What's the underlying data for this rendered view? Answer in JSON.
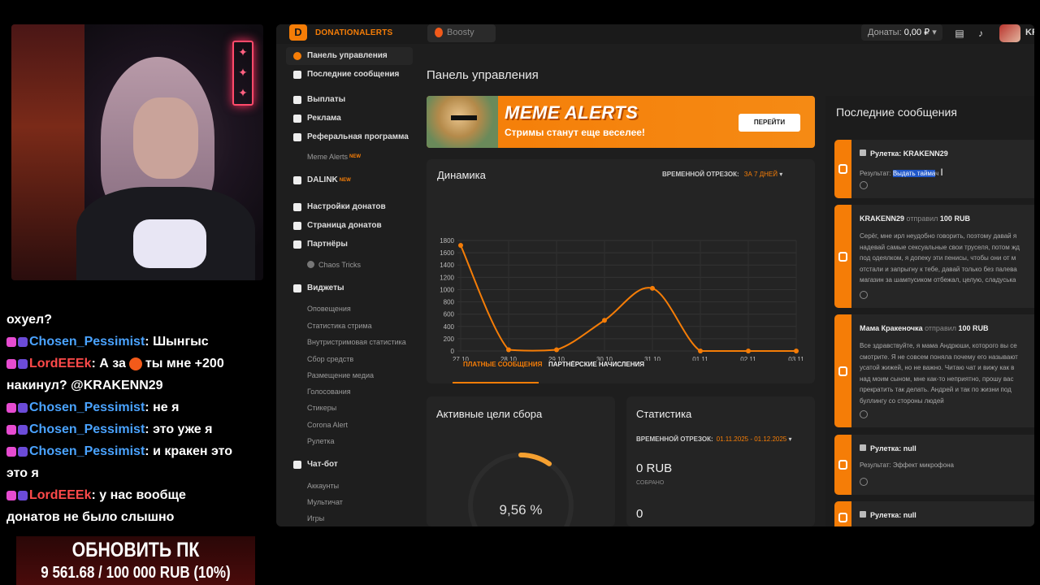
{
  "stream": {
    "chat": [
      {
        "user": "",
        "text": "охуел?"
      },
      {
        "user": "Chosen_Pessimist",
        "text": "Шынгыс"
      },
      {
        "user": "LordEEEk",
        "text": "А за",
        "tail": "ты мне +200"
      },
      {
        "user": "",
        "text": "накинул? @KRAKENN29"
      },
      {
        "user": "Chosen_Pessimist",
        "text": "не я"
      },
      {
        "user": "Chosen_Pessimist",
        "text": "это уже я"
      },
      {
        "user": "Chosen_Pessimist",
        "text": "и кракен это"
      },
      {
        "user": "",
        "text": "это я"
      },
      {
        "user": "LordEEEk",
        "text": "у нас вообще"
      },
      {
        "user": "",
        "text": "донатов не было слышно"
      }
    ],
    "goal": {
      "title": "ОБНОВИТЬ ПК",
      "progress_text": "9 561.68 / 100 000 RUB (10%)",
      "progress": 0.0956
    }
  },
  "app": {
    "brand": "DONATIONALERTS",
    "tab": "Boosty",
    "donations_label": "Донаты:",
    "donations_value": "0,00 ₽",
    "user_short": "KR",
    "sidebar": [
      {
        "label": "Панель управления",
        "active": true
      },
      {
        "label": "Последние сообщения"
      },
      {
        "label": "Выплаты"
      },
      {
        "label": "Реклама"
      },
      {
        "label": "Реферальная программа"
      },
      {
        "label": "Meme Alerts",
        "sub": true,
        "new": "NEW"
      },
      {
        "label": "DALINK",
        "new": "NEW"
      },
      {
        "label": "Настройки донатов"
      },
      {
        "label": "Страница донатов"
      },
      {
        "label": "Партнёры"
      },
      {
        "label": "Chaos Tricks",
        "sub": true
      },
      {
        "label": "Виджеты"
      },
      {
        "label": "Оповещения",
        "sub": true
      },
      {
        "label": "Статистика стрима",
        "sub": true
      },
      {
        "label": "Внутристримовая статистика",
        "sub": true
      },
      {
        "label": "Сбор средств",
        "sub": true
      },
      {
        "label": "Размещение медиа",
        "sub": true
      },
      {
        "label": "Голосования",
        "sub": true
      },
      {
        "label": "Стикеры",
        "sub": true
      },
      {
        "label": "Corona Alert",
        "sub": true
      },
      {
        "label": "Рулетка",
        "sub": true
      },
      {
        "label": "Чат-бот"
      },
      {
        "label": "Аккаунты",
        "sub": true
      },
      {
        "label": "Мультичат",
        "sub": true
      },
      {
        "label": "Игры",
        "sub": true
      }
    ],
    "page_title": "Панель управления",
    "banner": {
      "title": "MEME ALERTS",
      "subtitle": "Стримы станут еще веселее!",
      "button": "ПЕРЕЙТИ"
    },
    "dynamics": {
      "title": "Динамика",
      "period_label": "ВРЕМЕННОЙ ОТРЕЗОК:",
      "period_value": "ЗА 7 ДНЕЙ",
      "tab1": "ПЛАТНЫЕ СООБЩЕНИЯ",
      "tab2": "ПАРТНЁРСКИЕ НАЧИСЛЕНИЯ"
    },
    "goals": {
      "title": "Активные цели сбора",
      "percent": "9,56 %",
      "fraction": 0.0956
    },
    "stats": {
      "title": "Статистика",
      "period_label": "ВРЕМЕННОЙ ОТРЕЗОК:",
      "period_value": "01.11.2025 - 01.12.2025",
      "collected": "0 RUB",
      "collected_label": "СОБРАНО",
      "second": "0"
    },
    "messages": {
      "title": "Последние сообщения",
      "items": [
        {
          "header": "Рулетка: KRAKENN29",
          "result_label": "Результат:",
          "result": "Выдать тайма",
          "cut": "ч"
        },
        {
          "name": "KRAKENN29",
          "sent": "отправил",
          "amount": "100 RUB",
          "lines": [
            "Серёг, мне ирл неудобно говорить, поэтому давай я",
            "надевай самые сексуальные свои труселя, потом жд",
            "под одеялком, я допеку эти пенисы, чтобы они от м",
            "отстали и запрыгну к тебе, давай только без палева",
            "магазин за шампусиком отбежал, целую, сладуська"
          ]
        },
        {
          "name": "Мама Кракеночка",
          "sent": "отправил",
          "amount": "100 RUB",
          "lines": [
            "Все здравствуйте, я мама Андрюши, которого вы се",
            "смотрите. Я не совсем поняла почему его называют",
            "усатой жижей, но не важно. Читаю чат и вижу как в",
            "над моим сыном, мне как-то неприятно, прошу вас",
            "прекратить так делать. Андрей и так по жизни под",
            "буллингу со стороны людей"
          ]
        },
        {
          "header": "Рулетка: null",
          "result_label": "Результат:",
          "result": "Эффект микрофона"
        },
        {
          "header": "Рулетка: null"
        }
      ]
    }
  },
  "chart_data": {
    "type": "line",
    "categories": [
      "27.10",
      "28.10",
      "29.10",
      "30.10",
      "31.10",
      "01.11",
      "02.11",
      "03.11"
    ],
    "series": [
      {
        "values": [
          1720,
          20,
          20,
          500,
          1020,
          0,
          0,
          0
        ]
      }
    ],
    "ylim": [
      0,
      1800
    ],
    "yticks": [
      "0",
      "200",
      "400",
      "600",
      "800",
      "1000",
      "1200",
      "1400",
      "1600",
      "1800"
    ],
    "grid": true,
    "color": "#f57d07"
  }
}
